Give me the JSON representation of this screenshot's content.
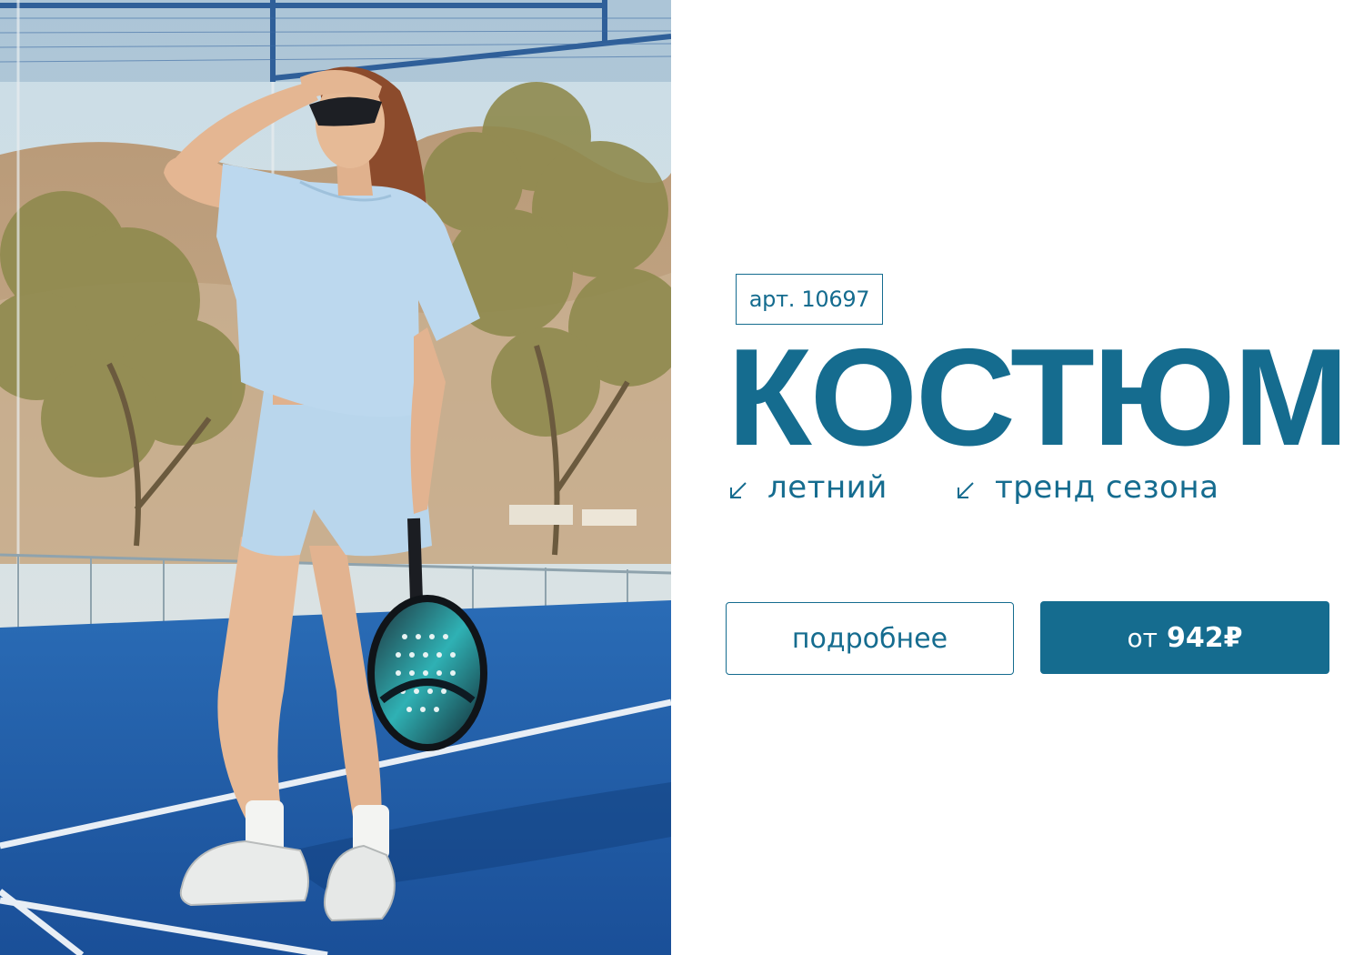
{
  "product": {
    "sku_label": "арт. 10697",
    "title": "КОСТЮМ",
    "tags": [
      {
        "icon": "arrow-down-left-icon",
        "label": "летний"
      },
      {
        "icon": "arrow-down-left-icon",
        "label": "тренд сезона"
      }
    ]
  },
  "actions": {
    "details_label": "подробнее",
    "price_prefix": "от",
    "price_value": "942₽"
  },
  "colors": {
    "brand": "#156c8f",
    "court": "#1f5fae",
    "outfit": "#b7d6ec"
  }
}
